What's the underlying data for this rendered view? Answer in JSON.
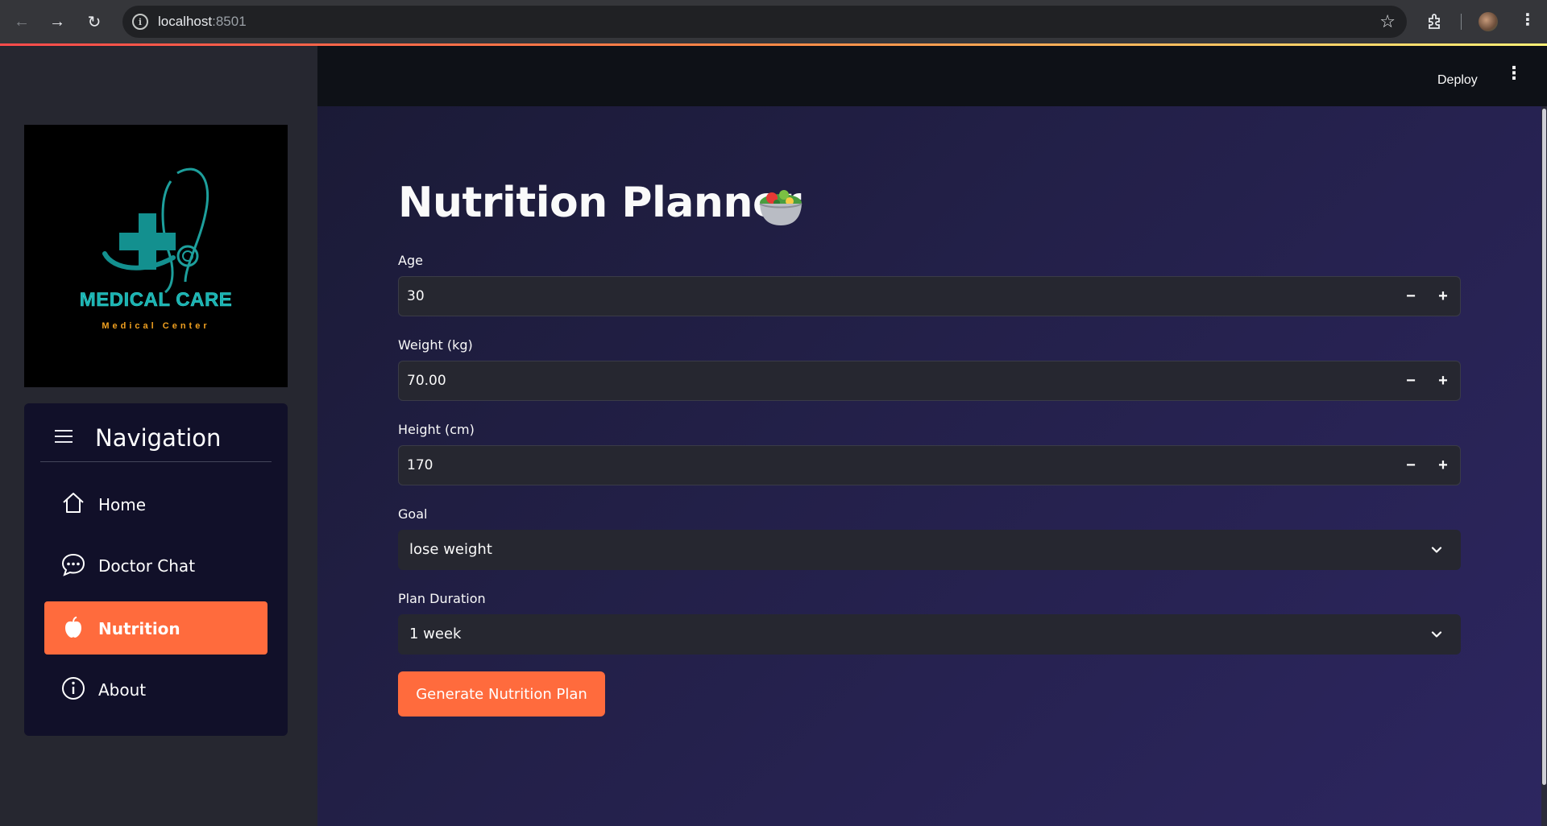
{
  "browser": {
    "url_host": "localhost",
    "url_port": ":8501"
  },
  "header": {
    "deploy_label": "Deploy"
  },
  "logo": {
    "brand": "MEDICAL CARE",
    "subtitle": "Medical Center"
  },
  "sidebar": {
    "nav_title": "Navigation",
    "items": [
      {
        "label": "Home",
        "icon": "home-icon",
        "active": false
      },
      {
        "label": "Doctor Chat",
        "icon": "chat-icon",
        "active": false
      },
      {
        "label": "Nutrition",
        "icon": "apple-icon",
        "active": true
      },
      {
        "label": "About",
        "icon": "info-icon",
        "active": false
      }
    ]
  },
  "main": {
    "title": "Nutrition Planner",
    "title_icon": "salad-icon",
    "fields": {
      "age": {
        "label": "Age",
        "value": "30"
      },
      "weight": {
        "label": "Weight (kg)",
        "value": "70.00"
      },
      "height": {
        "label": "Height (cm)",
        "value": "170"
      },
      "goal": {
        "label": "Goal",
        "value": "lose weight"
      },
      "duration": {
        "label": "Plan Duration",
        "value": "1 week"
      }
    },
    "generate_label": "Generate Nutrition Plan"
  },
  "colors": {
    "accent": "#ff6b3d",
    "brand_teal": "#19b2b1",
    "subtitle_gold": "#f0a020"
  }
}
